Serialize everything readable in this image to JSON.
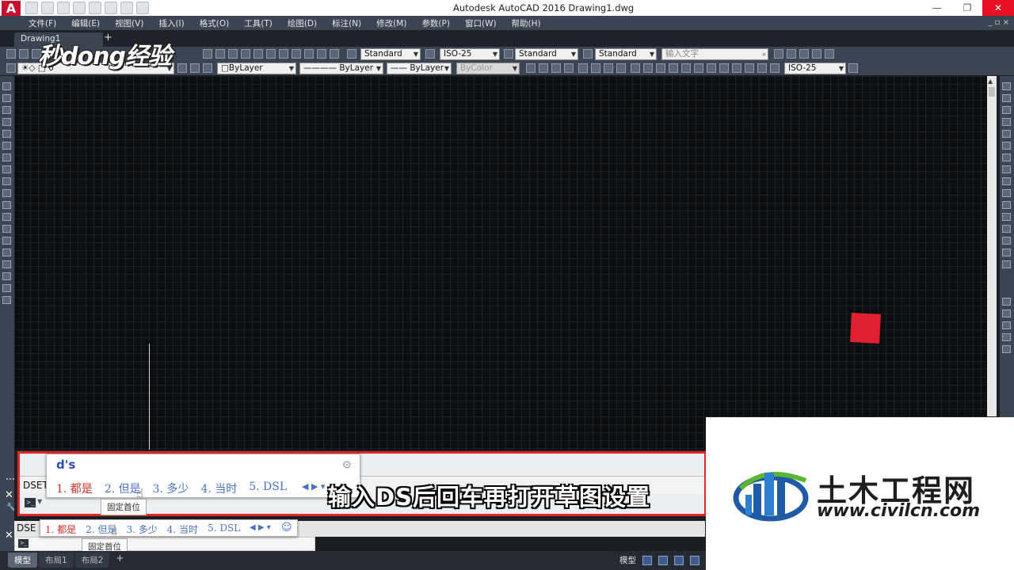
{
  "titlebar": {
    "app_logo": "A",
    "title": "Autodesk AutoCAD 2016    Drawing1.dwg",
    "minimize": "—",
    "restore": "❐",
    "close": "✕"
  },
  "menu": {
    "items": [
      "文件(F)",
      "编辑(E)",
      "视图(V)",
      "插入(I)",
      "格式(O)",
      "工具(T)",
      "绘图(D)",
      "标注(N)",
      "修改(M)",
      "参数(P)",
      "窗口(W)",
      "帮助(H)"
    ],
    "mdi_controls": "_ ▫ ×"
  },
  "tabs": {
    "doc_tab": "Drawing1",
    "add": "+"
  },
  "watermark": "秒dong经验",
  "toolbar1": {
    "text_style": "Standard",
    "dim_style": "ISO-25",
    "table_style": "Standard",
    "mleader_style": "Standard",
    "search_placeholder": "输入文字"
  },
  "toolbar2": {
    "layer": "0",
    "color": "ByLayer",
    "linetype": "———— ByLayer",
    "lineweight": "—— ByLayer",
    "plotstyle": "ByColor",
    "dim_style": "ISO-25"
  },
  "command_line": {
    "history_text": "DSET",
    "ime_composition": "d's",
    "ime_gear": "⚙",
    "candidates": [
      "1. 都是",
      "2. 但是",
      "3. 多少",
      "4. 当时",
      "5. DSL"
    ],
    "nav": "◀ ▶ ▾",
    "tooltip": "固定首位"
  },
  "command_line_lower": {
    "history_text": "DSE",
    "candidates": [
      "1. 都是",
      "2. 但是",
      "3. 多少",
      "4. 当时",
      "5. DSL"
    ],
    "nav": "◀ ▶ ▾",
    "smile": "☺",
    "tooltip": "固定首位"
  },
  "statusbar": {
    "layout_tabs": [
      "模型",
      "布局1",
      "布局2"
    ],
    "add": "+",
    "model_label": "模型"
  },
  "overlay": {
    "subtitle": "输入DS后回车再打开草图设置",
    "brand_name": "土木工程网",
    "brand_url": "www.civilcn.com"
  },
  "colors": {
    "accent_red": "#e02a2a",
    "square": "#e02030",
    "brand_blue": "#1f5aa6",
    "brand_green": "#5cb531"
  }
}
